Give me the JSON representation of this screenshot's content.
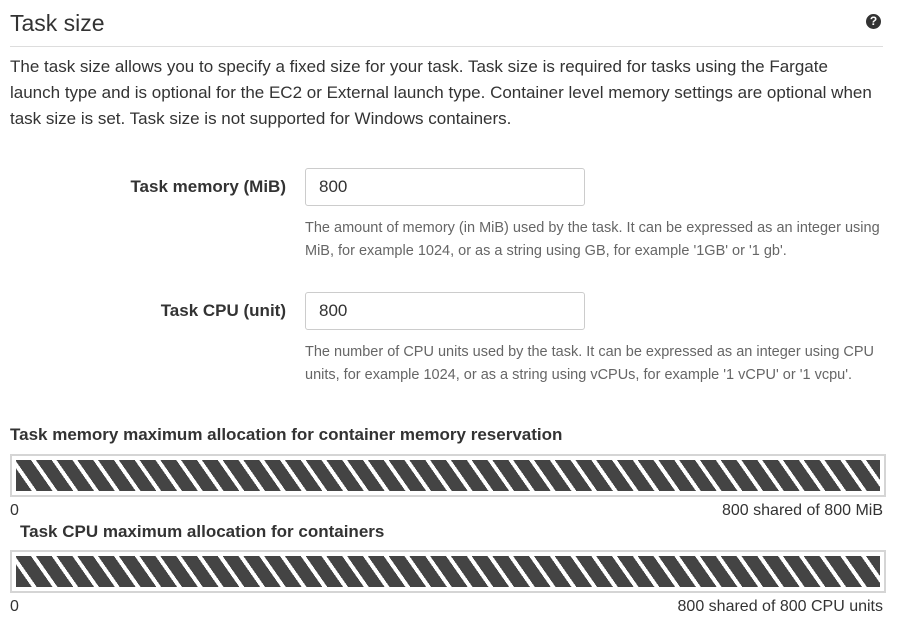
{
  "header": {
    "title": "Task size",
    "help_icon": "question-circle-icon"
  },
  "description": "The task size allows you to specify a fixed size for your task. Task size is required for tasks using the Fargate launch type and is optional for the EC2 or External launch type. Container level memory settings are optional when task size is set. Task size is not supported for Windows containers.",
  "task_memory": {
    "label": "Task memory (MiB)",
    "value": "800",
    "help": "The amount of memory (in MiB) used by the task. It can be expressed as an integer using MiB, for example 1024, or as a string using GB, for example '1GB' or '1 gb'."
  },
  "task_cpu": {
    "label": "Task CPU (unit)",
    "value": "800",
    "help": "The number of CPU units used by the task. It can be expressed as an integer using CPU units, for example 1024, or as a string using vCPUs, for example '1 vCPU' or '1 vcpu'."
  },
  "memory_allocation": {
    "label": "Task memory maximum allocation for container memory reservation",
    "min_label": "0",
    "max_label": "800 shared of 800 MiB",
    "fill_fraction": 1.0
  },
  "cpu_allocation": {
    "label": "Task CPU maximum allocation for containers",
    "min_label": "0",
    "max_label": "800 shared of 800 CPU units",
    "fill_fraction": 1.0
  },
  "colors": {
    "text": "#333333",
    "help_text": "#666666",
    "bar_stripe_dark": "#444444",
    "bar_border": "#d5d5d5",
    "input_border": "#cccccc"
  }
}
